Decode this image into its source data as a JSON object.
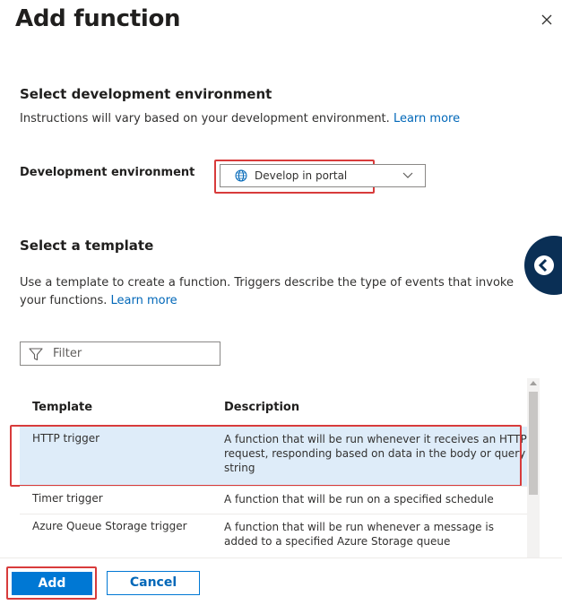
{
  "panel": {
    "title": "Add function"
  },
  "dev_env": {
    "heading": "Select development environment",
    "instructions": "Instructions will vary based on your development environment.",
    "learn_more": "Learn more",
    "label": "Development environment",
    "selected": "Develop in portal"
  },
  "template": {
    "heading": "Select a template",
    "description_line1": "Use a template to create a function. Triggers describe the type of events that invoke",
    "description_line2": "your functions.",
    "learn_more": "Learn more",
    "filter_placeholder": "Filter",
    "columns": [
      "Template",
      "Description"
    ],
    "rows": [
      {
        "name": "HTTP trigger",
        "description": "A function that will be run whenever it receives an HTTP request, responding based on data in the body or query string"
      },
      {
        "name": "Timer trigger",
        "description": "A function that will be run on a specified schedule"
      },
      {
        "name": "Azure Queue Storage trigger",
        "description": "A function that will be run whenever a message is added to a specified Azure Storage queue"
      }
    ],
    "selected_row": 0
  },
  "footer": {
    "add_label": "Add",
    "cancel_label": "Cancel"
  },
  "colors": {
    "accent": "#0078d4",
    "highlight": "#d83b3b",
    "selected_row": "#deecf9"
  }
}
